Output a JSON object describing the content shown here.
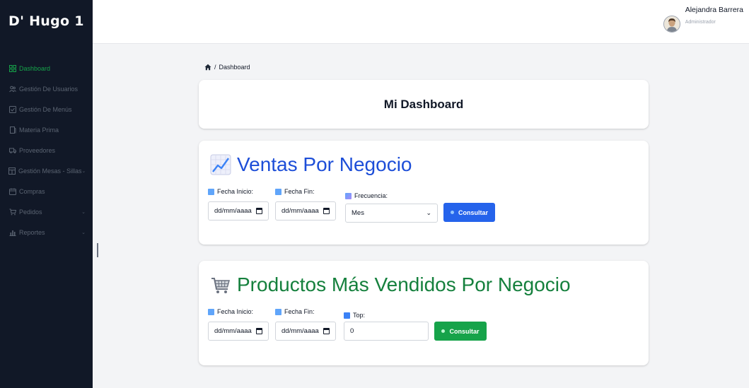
{
  "brand": "D' Hugo 1",
  "sidebar": {
    "items": [
      {
        "label": "Dashboard",
        "icon": "grid-icon",
        "active": true,
        "chevron": false
      },
      {
        "label": "Gestión De Usuarios",
        "icon": "users-icon",
        "active": false,
        "chevron": false
      },
      {
        "label": "Gestión De Menús",
        "icon": "checkbox-icon",
        "active": false,
        "chevron": false
      },
      {
        "label": "Materia Prima",
        "icon": "box-icon",
        "active": false,
        "chevron": false
      },
      {
        "label": "Proveedores",
        "icon": "truck-icon",
        "active": false,
        "chevron": false
      },
      {
        "label": "Gestión Mesas - Sillas",
        "icon": "table-icon",
        "active": false,
        "chevron": true
      },
      {
        "label": "Compras",
        "icon": "calendar-icon",
        "active": false,
        "chevron": false
      },
      {
        "label": "Pedidos",
        "icon": "cart-icon",
        "active": false,
        "chevron": true
      },
      {
        "label": "Reportes",
        "icon": "chart-icon",
        "active": false,
        "chevron": true
      }
    ],
    "chevron_glyph": "⌄"
  },
  "user": {
    "name": "Alejandra Barrera",
    "role": "Administrador"
  },
  "breadcrumb": {
    "separator": "/",
    "current": "Dashboard"
  },
  "dashboard_title": "Mi Dashboard",
  "ventas": {
    "title": "Ventas Por Negocio",
    "fecha_inicio_label": "Fecha Inicio:",
    "fecha_inicio_value": "dd/mm/aaaa",
    "fecha_fin_label": "Fecha Fin:",
    "fecha_fin_value": "dd/mm/aaaa",
    "frecuencia_label": "Frecuencia:",
    "frecuencia_value": "Mes",
    "button": "Consultar"
  },
  "productos": {
    "title": "Productos Más Vendidos Por Negocio",
    "fecha_inicio_label": "Fecha Inicio:",
    "fecha_inicio_value": "dd/mm/aaaa",
    "fecha_fin_label": "Fecha Fin:",
    "fecha_fin_value": "dd/mm/aaaa",
    "top_label": "Top:",
    "top_value": "0",
    "button": "Consultar"
  },
  "colors": {
    "sidebar_bg": "#111827",
    "active": "#16a34a",
    "ventas_title": "#1d4ed8",
    "productos_title": "#15803d",
    "button_blue": "#2563eb",
    "button_green": "#16a34a"
  }
}
